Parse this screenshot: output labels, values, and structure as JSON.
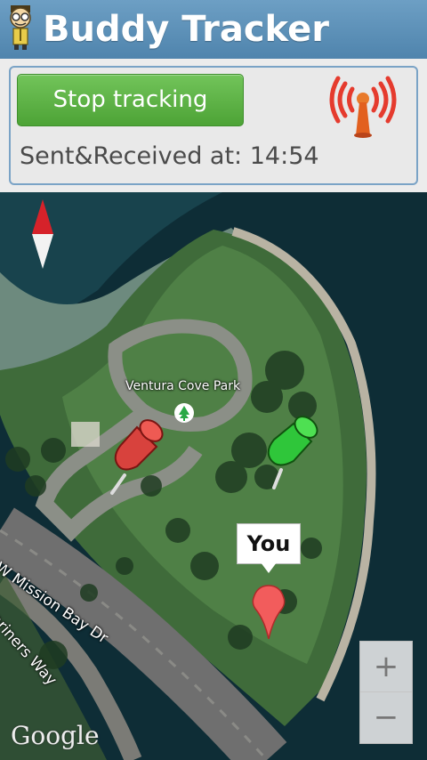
{
  "app": {
    "title": "Buddy Tracker",
    "icon": "buddy-avatar-icon"
  },
  "tracking": {
    "button_label": "Stop tracking",
    "status_text": "Sent&Received at: 14:54",
    "signal_icon": "broadcast-signal-icon"
  },
  "map": {
    "park_label": "Ventura Cove Park",
    "road_label_1": "W Mission Bay Dr",
    "road_label_2": "ariners Way",
    "you_label": "You",
    "zoom_in": "+",
    "zoom_out": "−",
    "attribution": "Google",
    "pins": [
      {
        "name": "red-pushpin-icon",
        "color": "#e0433d"
      },
      {
        "name": "green-pushpin-icon",
        "color": "#2fc63a"
      }
    ],
    "you_marker_color": "#f25c5c"
  },
  "colors": {
    "title_bar": "#5a8fb8",
    "button_green": "#5cb243",
    "panel_border": "#7aa3c6"
  }
}
